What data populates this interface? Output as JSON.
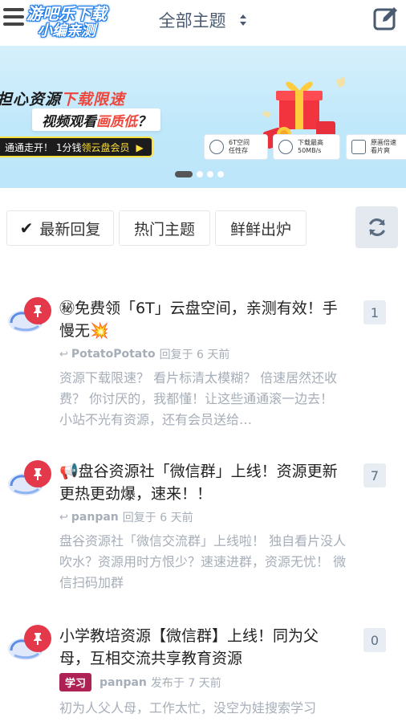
{
  "header": {
    "watermark_line1": "游吧乐下载",
    "watermark_line2": "小编亲测",
    "title": "全部主题"
  },
  "banner": {
    "line1_prefix": "担心资源",
    "line1_highlight": "下载限速",
    "line2_prefix": "视频观看",
    "line2_highlight": "画质低",
    "line2_suffix": "？",
    "cta_prefix": "通通走开！ 1分钱",
    "cta_highlight": "领云盘会员",
    "features": [
      {
        "icon": "cube-icon",
        "text": "6T空间\n任性存"
      },
      {
        "icon": "download-cloud-icon",
        "text": "下载最高\n50MB/s"
      },
      {
        "icon": "play-icon",
        "text": "原画倍速\n看片爽"
      }
    ],
    "pages": 4,
    "active_page": 0
  },
  "tabs": [
    {
      "label": "最新回复",
      "selected": true
    },
    {
      "label": "热门主题",
      "selected": false
    },
    {
      "label": "鲜鲜出炉",
      "selected": false
    }
  ],
  "discussions": [
    {
      "title": "㊙免费领「6T」云盘空间，亲测有效！手慢无💥",
      "user": "PotatoPotato",
      "action": "回复于 6 天前",
      "excerpt": "资源下载限速？ 看片标清太模糊？ 倍速居然还收费？ 你讨厌的，我都懂！让这些通通滚一边去！ 小站不光有资源，还有会员送给…",
      "count": "1",
      "tag": ""
    },
    {
      "title": "📢盘谷资源社「微信群」上线！资源更新更热更劲爆，速来！！",
      "user": "panpan",
      "action": "回复于 6 天前",
      "excerpt": "盘谷资源社「微信交流群」上线啦！ 独自看片没人吹水？资源用时方恨少？速速进群，资源无忧！ 微信扫码加群",
      "count": "7",
      "tag": ""
    },
    {
      "title": "小学教培资源【微信群】上线！同为父母，互相交流共享教育资源",
      "user": "panpan",
      "action": "发布于 7 天前",
      "excerpt": "初为人父人母，工作太忙，没空为娃搜索学习",
      "count": "0",
      "tag": "学习"
    }
  ],
  "colors": {
    "pin": "#e3394b",
    "tag": "#ad2155",
    "header_title": "#4a5a70",
    "meta": "#a6aeb8"
  }
}
